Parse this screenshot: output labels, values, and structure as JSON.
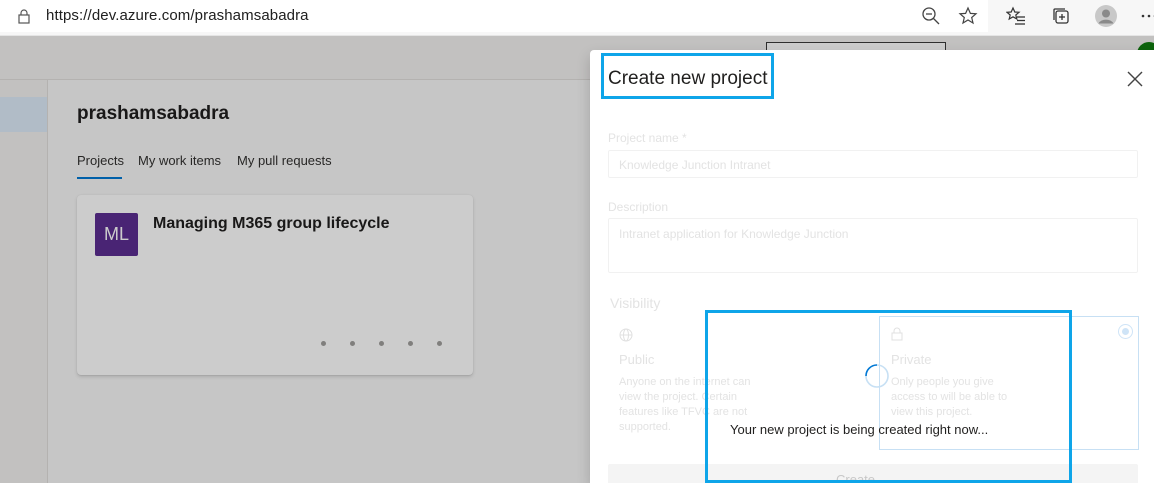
{
  "browser": {
    "url": "https://dev.azure.com/prashamsabadra",
    "icons": [
      "lock-icon",
      "zoom-out-icon",
      "favorite-star-icon",
      "favorites-list-icon",
      "collections-icon",
      "profile-icon",
      "more-icon"
    ]
  },
  "org": {
    "name": "prashamsabadra",
    "tabs": [
      "Projects",
      "My work items",
      "My pull requests"
    ]
  },
  "project_card": {
    "initials": "ML",
    "name": "Managing M365 group lifecycle",
    "avatar_color": "#5c2e91"
  },
  "panel": {
    "title": "Create new project",
    "project_name_label": "Project name *",
    "project_name_value": "Knowledge Junction Intranet",
    "description_label": "Description",
    "description_value": "Intranet application for Knowledge Junction",
    "visibility_label": "Visibility",
    "options": [
      {
        "title": "Public",
        "description": "Anyone on the internet can view the project. Certain features like TFVC are not supported."
      },
      {
        "title": "Private",
        "description": "Only people you give access to will be able to view this project."
      }
    ],
    "create_label": "Create",
    "progress_text": "Your new project is being created right now..."
  },
  "colors": {
    "highlight": "#0ea5e9",
    "accent": "#0078d4"
  }
}
